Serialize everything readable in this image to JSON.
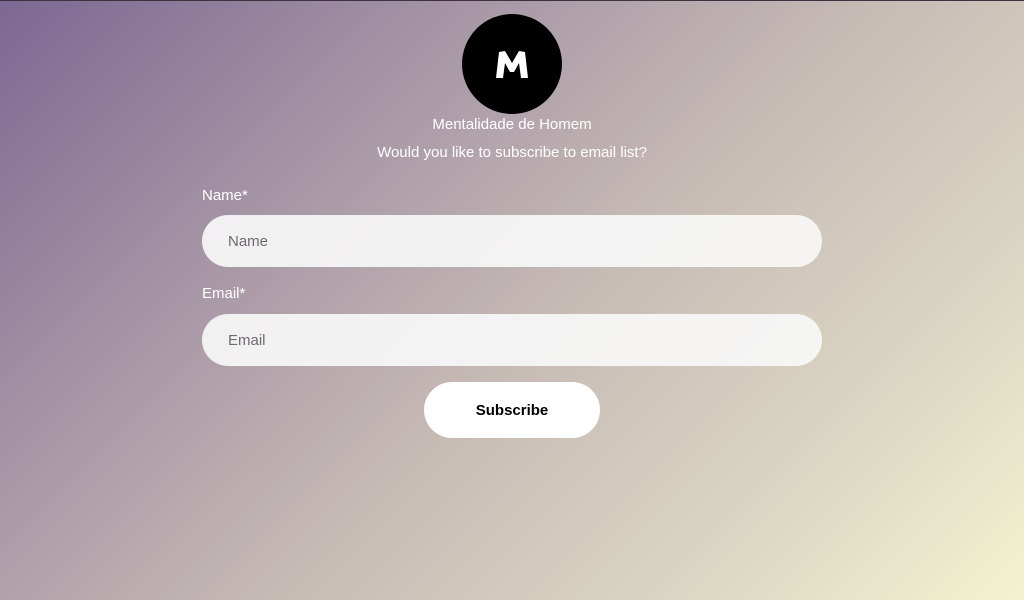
{
  "profile": {
    "avatar_icon": "m-logo-icon",
    "name": "Mentalidade de Homem"
  },
  "form": {
    "prompt": "Would you like to subscribe to email list?",
    "name_label": "Name*",
    "name_placeholder": "Name",
    "name_value": "",
    "email_label": "Email*",
    "email_placeholder": "Email",
    "email_value": "",
    "submit_label": "Subscribe"
  },
  "colors": {
    "gradient_start": "#7d6893",
    "gradient_end": "#f3f3d0",
    "avatar_bg": "#000000",
    "button_bg": "#ffffff"
  }
}
